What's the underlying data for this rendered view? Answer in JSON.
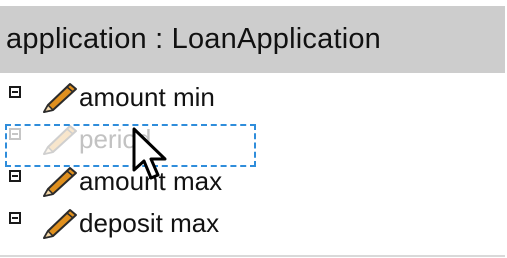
{
  "header": {
    "title": "application : LoanApplication"
  },
  "fields": [
    {
      "label": "amount min",
      "icon": "pencil-icon",
      "state": "normal"
    },
    {
      "label": "period",
      "icon": "pencil-icon",
      "state": "dragging"
    },
    {
      "label": "amount max",
      "icon": "pencil-icon",
      "state": "normal"
    },
    {
      "label": "deposit max",
      "icon": "pencil-icon",
      "state": "normal"
    }
  ],
  "colors": {
    "header_background": "#cdcdcd",
    "drag_outline": "#2f8ddb",
    "pencil_body": "#e0901e",
    "pencil_outline": "#2b2b2b"
  }
}
